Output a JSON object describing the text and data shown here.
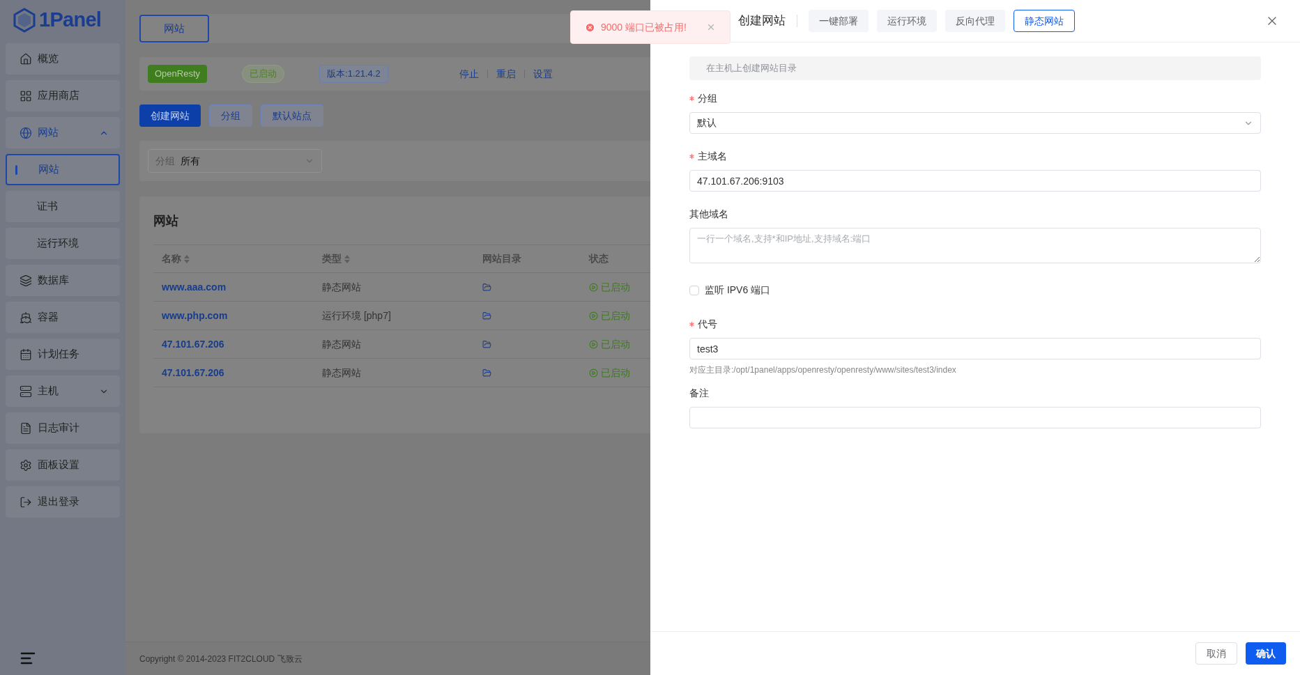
{
  "sidebar": {
    "logo": "1Panel",
    "items": [
      {
        "label": "概览",
        "selected": false
      },
      {
        "label": "应用商店",
        "selected": false
      },
      {
        "label": "网站",
        "selected": true,
        "expanded": true,
        "children": [
          {
            "label": "网站",
            "selected": true
          },
          {
            "label": "证书",
            "selected": false
          },
          {
            "label": "运行环境",
            "selected": false
          }
        ]
      },
      {
        "label": "数据库",
        "selected": false
      },
      {
        "label": "容器",
        "selected": false
      },
      {
        "label": "计划任务",
        "selected": false
      },
      {
        "label": "主机",
        "selected": false,
        "expanded": false
      },
      {
        "label": "日志审计",
        "selected": false
      },
      {
        "label": "面板设置",
        "selected": false
      },
      {
        "label": "退出登录",
        "selected": false
      }
    ]
  },
  "main": {
    "tabs": [
      {
        "label": "网站",
        "selected": true
      }
    ],
    "server": {
      "app": "OpenResty",
      "status": "已启动",
      "version": "版本:1.21.4.2",
      "actions": [
        "停止",
        "重启",
        "设置"
      ]
    },
    "toolbar": [
      {
        "label": "创建网站",
        "kind": "primary"
      },
      {
        "label": "分组",
        "kind": "plain"
      },
      {
        "label": "默认站点",
        "kind": "plain"
      }
    ],
    "filter": {
      "label": "分组",
      "value": "所有"
    },
    "table": {
      "title": "网站",
      "columns": [
        {
          "label": "名称",
          "sortable": true
        },
        {
          "label": "类型",
          "sortable": true
        },
        {
          "label": "网站目录",
          "sortable": false
        },
        {
          "label": "状态",
          "sortable": false
        }
      ],
      "rows": [
        {
          "name": "www.aaa.com",
          "type": "静态网站",
          "status": "已启动"
        },
        {
          "name": "www.php.com",
          "type": "运行环境 [php7]",
          "status": "已启动"
        },
        {
          "name": "47.101.67.206",
          "type": "静态网站",
          "status": "已启动"
        },
        {
          "name": "47.101.67.206",
          "type": "静态网站",
          "status": "已启动"
        }
      ]
    },
    "footer": "Copyright © 2014-2023 FIT2CLOUD 飞致云"
  },
  "toast": {
    "message": "9000 端口已被占用!"
  },
  "drawer": {
    "title": "创建网站",
    "tabs": [
      {
        "label": "一键部署",
        "selected": false
      },
      {
        "label": "运行环境",
        "selected": false
      },
      {
        "label": "反向代理",
        "selected": false
      },
      {
        "label": "静态网站",
        "selected": true
      }
    ],
    "notice": "在主机上创建网站目录",
    "fields": [
      {
        "kind": "select",
        "label": "分组",
        "required": true,
        "value": "默认"
      },
      {
        "kind": "input",
        "label": "主域名",
        "required": true,
        "value": "47.101.67.206:9103"
      },
      {
        "kind": "textarea",
        "label": "其他域名",
        "required": false,
        "placeholder": "一行一个域名,支持*和IP地址,支持域名:端口"
      },
      {
        "kind": "checkbox",
        "label": "监听 IPV6 端口",
        "checked": false
      },
      {
        "kind": "input",
        "label": "代号",
        "required": true,
        "value": "test3",
        "hint": "对应主目录:/opt/1panel/apps/openresty/openresty/www/sites/test3/index"
      },
      {
        "kind": "input",
        "label": "备注",
        "required": false
      }
    ],
    "buttons": [
      {
        "label": "取消",
        "kind": "plain"
      },
      {
        "label": "确认",
        "kind": "primary"
      }
    ]
  }
}
